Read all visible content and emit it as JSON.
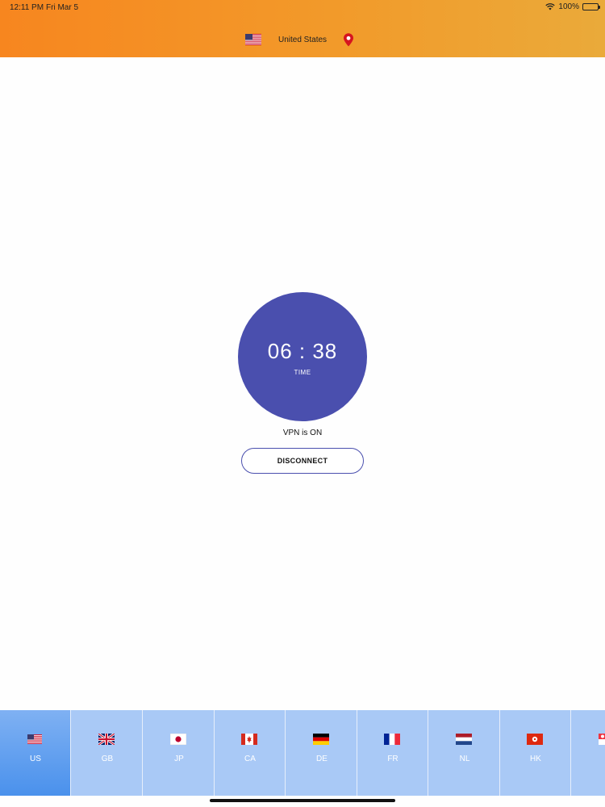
{
  "status_bar": {
    "time": "12:11 PM",
    "date": "Fri Mar 5",
    "battery": "100%"
  },
  "header": {
    "country_name": "United States",
    "flag_icon": "us-flag-icon",
    "location_icon": "location-pin-icon"
  },
  "timer": {
    "value": "06 : 38",
    "label": "TIME",
    "color": "#4a4fae"
  },
  "vpn_status": "VPN is ON",
  "disconnect_label": "DISCONNECT",
  "countries": [
    {
      "code": "US",
      "selected": true
    },
    {
      "code": "GB",
      "selected": false
    },
    {
      "code": "JP",
      "selected": false
    },
    {
      "code": "CA",
      "selected": false
    },
    {
      "code": "DE",
      "selected": false
    },
    {
      "code": "FR",
      "selected": false
    },
    {
      "code": "NL",
      "selected": false
    },
    {
      "code": "HK",
      "selected": false
    },
    {
      "code": "S",
      "selected": false
    }
  ],
  "colors": {
    "header_start": "#f7861f",
    "header_end": "#eaaa3a",
    "tabbar": "#a9c9f6",
    "tab_selected": "#4a91ec"
  }
}
